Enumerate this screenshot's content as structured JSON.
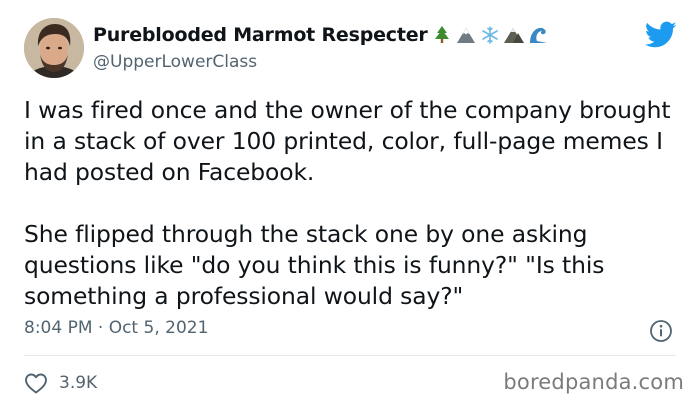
{
  "author": {
    "display_name": "Pureblooded Marmot Respecter",
    "handle": "@UpperLowerClass",
    "name_emojis": [
      "evergreen-tree-icon",
      "snow-capped-mountain-icon",
      "snowflake-icon",
      "mountain-icon",
      "water-wave-icon"
    ]
  },
  "tweet": {
    "paragraph_1": "I was fired once and the owner of the company brought in a stack of over 100 printed, color, full-page memes I had posted on Facebook.",
    "paragraph_2": "She flipped through the stack one by one asking questions like \"do you think this is funny?\" \"Is this something a professional would say?\"",
    "timestamp": "8:04 PM · Oct 5, 2021",
    "like_count": "3.9K"
  },
  "icons": {
    "brand": "twitter-bird-icon",
    "info": "info-icon",
    "like": "heart-outline-icon"
  },
  "watermark": "boredpanda.com",
  "colors": {
    "twitter_blue": "#1d9bf0",
    "text_primary": "#0f1419",
    "text_secondary": "#536471",
    "divider": "#e3e8ec"
  }
}
